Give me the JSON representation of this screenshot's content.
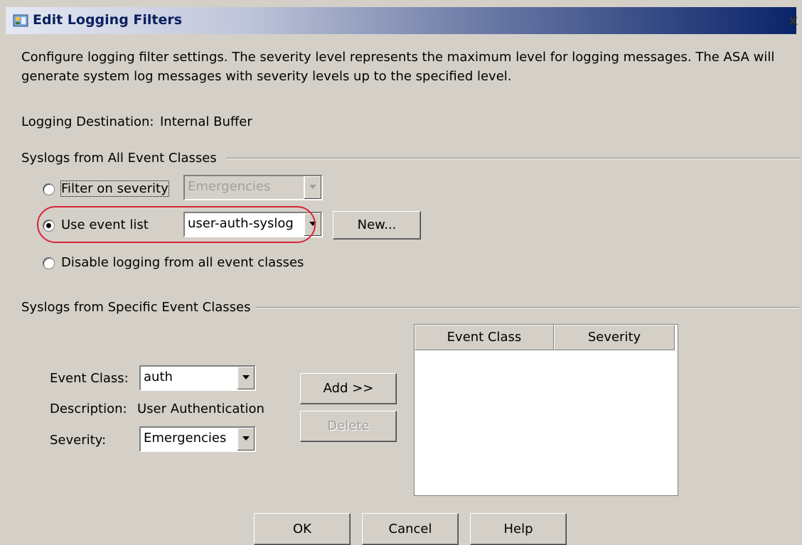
{
  "window": {
    "title": "Edit Logging Filters",
    "close_glyph": "x"
  },
  "description": "Configure logging filter settings. The severity level represents the maximum level for logging messages. The ASA will generate system log messages with severity levels up to the specified level.",
  "destination": {
    "label": "Logging Destination:",
    "value": "Internal Buffer"
  },
  "all_classes": {
    "title": "Syslogs from All Event Classes",
    "filter_severity": {
      "label": "Filter on severity",
      "value": "Emergencies",
      "selected": false
    },
    "use_event_list": {
      "label": "Use event list",
      "value": "user-auth-syslog",
      "selected": true,
      "new_button": "New..."
    },
    "disable_logging": {
      "label": "Disable logging from all event classes",
      "selected": false
    }
  },
  "specific_classes": {
    "title": "Syslogs from Specific Event Classes",
    "event_class": {
      "label": "Event Class:",
      "value": "auth"
    },
    "description": {
      "label": "Description:",
      "value": "User Authentication"
    },
    "severity": {
      "label": "Severity:",
      "value": "Emergencies"
    },
    "add_button": "Add >>",
    "delete_button": "Delete",
    "table": {
      "columns": [
        "Event Class",
        "Severity"
      ],
      "rows": []
    }
  },
  "buttons": {
    "ok": "OK",
    "cancel": "Cancel",
    "help": "Help"
  },
  "colors": {
    "dialog_bg": "#d4d0c8",
    "title_dark": "#0a246a",
    "highlight": "#d8243a"
  }
}
